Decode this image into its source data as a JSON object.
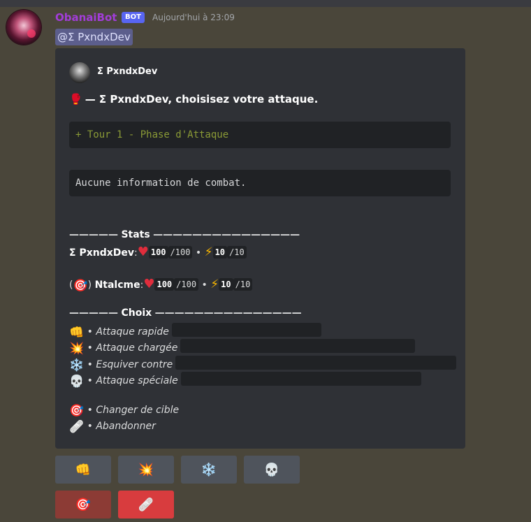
{
  "message": {
    "username": "ObanaiBot",
    "bot_tag": "BOT",
    "timestamp": "Aujourd'hui à 23:09",
    "mention": "@Σ PxndxDev"
  },
  "embed": {
    "author": "Σ PxndxDev",
    "title": "— Σ PxndxDev, choisisez votre attaque.",
    "title_emoji": "🥊",
    "phase": "+ Tour 1 - Phase d'Attaque",
    "combat_info": "Aucune information de combat.",
    "stats_header_left": "—————",
    "stats_header": "Stats",
    "stats_header_right": "———————————————",
    "player": {
      "name": "Σ PxndxDev",
      "hp": "100",
      "hp_max": "/100",
      "energy": "10",
      "energy_max": "/10"
    },
    "opponent": {
      "prefix": "(",
      "suffix": ")",
      "name": "Ntalcme",
      "hp": "100",
      "hp_max": "/100",
      "energy": "10",
      "energy_max": "/10"
    },
    "choices_header_left": "—————",
    "choices_header": "Choix",
    "choices_header_right": "———————————————",
    "choices": [
      {
        "emoji": "👊",
        "label": "Attaque rapide"
      },
      {
        "emoji": "💥",
        "label": "Attaque chargée"
      },
      {
        "emoji": "❄️",
        "label": "Esquiver contre"
      },
      {
        "emoji": "💀",
        "label": "Attaque spéciale"
      }
    ],
    "extra_choices": [
      {
        "emoji": "🎯",
        "label": "Changer de cible"
      },
      {
        "emoji": "🩹",
        "label": "Abandonner"
      }
    ],
    "bullet": "•"
  },
  "buttons": {
    "row1": [
      {
        "icon": "👊",
        "name": "fist-icon"
      },
      {
        "icon": "💥",
        "name": "explosion-icon"
      },
      {
        "icon": "❄️",
        "name": "snowflake-icon"
      },
      {
        "icon": "💀",
        "name": "skull-icon"
      }
    ],
    "row2": [
      {
        "icon": "🎯",
        "name": "target-icon"
      },
      {
        "icon": "🩹",
        "name": "bandage-icon"
      }
    ]
  },
  "colors": {
    "background": "#4a463a",
    "embed_bg": "#2f3136",
    "username": "#a23dd9",
    "bot_tag": "#5865f2",
    "diff_green": "#8a9a36",
    "button_grey": "#4f545c",
    "button_red": "#d83c3e"
  }
}
